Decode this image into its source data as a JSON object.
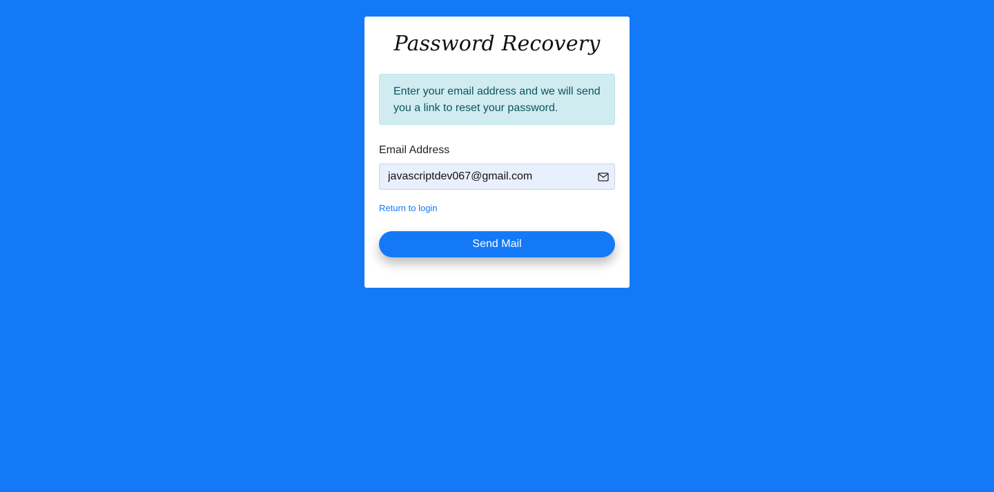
{
  "card": {
    "title": "Password Recovery",
    "info_message": "Enter your email address and we will send you a link to reset your password.",
    "email_label": "Email Address",
    "email_value": "javascriptdev067@gmail.com",
    "email_icon": "envelope-icon",
    "return_link_label": "Return to login",
    "send_button_label": "Send Mail"
  },
  "colors": {
    "background": "#1479f7",
    "accent": "#1479f7",
    "info_background": "#d1ecf0",
    "info_text": "#0c5460",
    "input_background": "#e8f0fe"
  }
}
